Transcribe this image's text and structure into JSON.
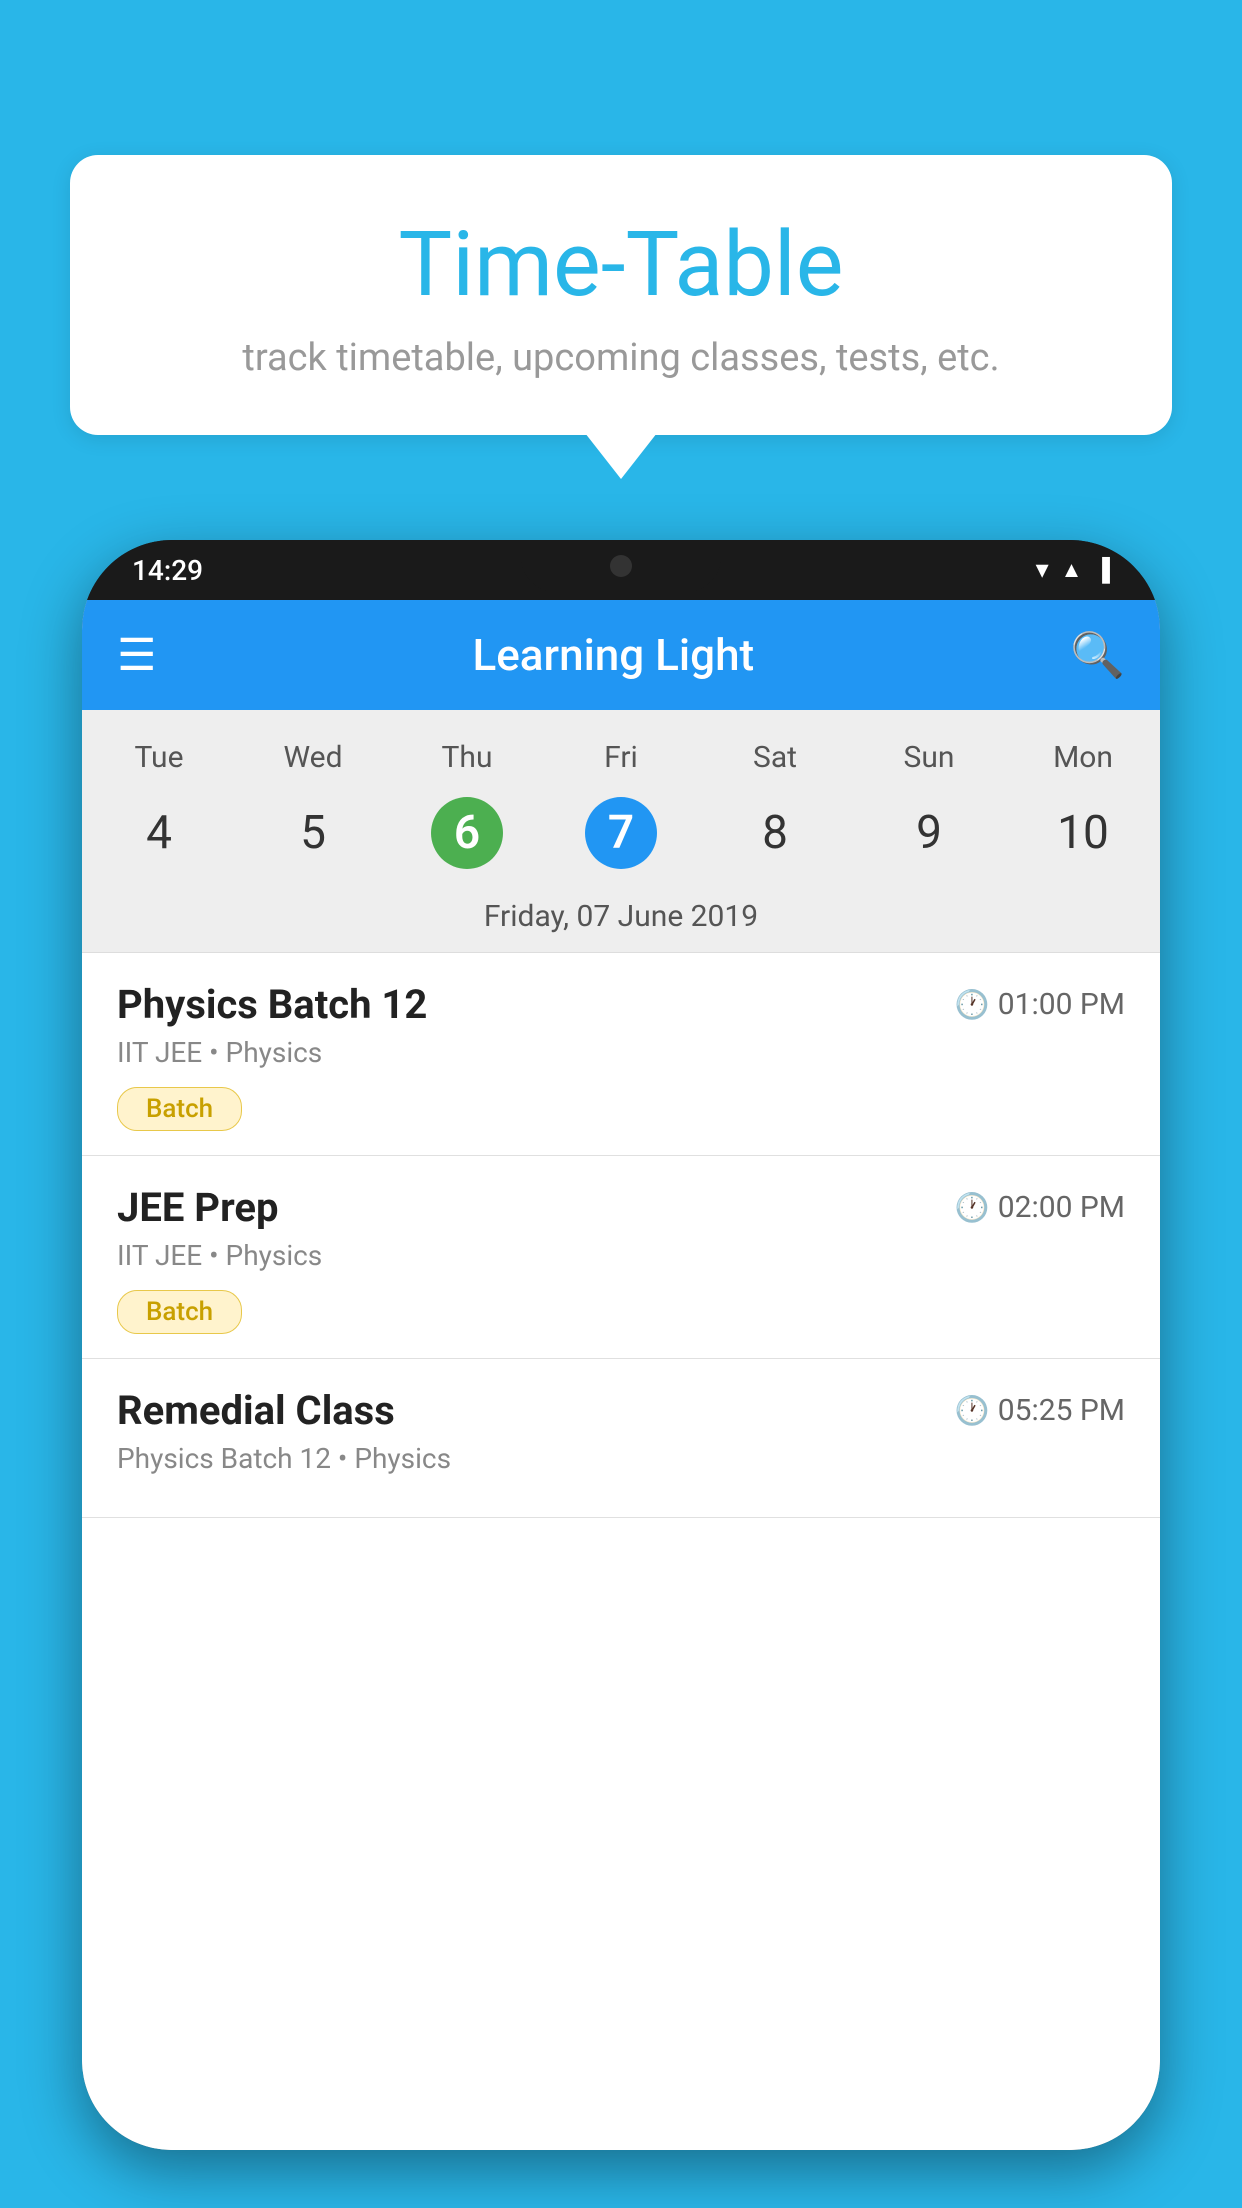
{
  "background_color": "#29b6e8",
  "bubble": {
    "title": "Time-Table",
    "subtitle": "track timetable, upcoming classes, tests, etc."
  },
  "phone": {
    "status_bar": {
      "time": "14:29"
    },
    "app_bar": {
      "title": "Learning Light"
    },
    "calendar": {
      "day_headers": [
        "Tue",
        "Wed",
        "Thu",
        "Fri",
        "Sat",
        "Sun",
        "Mon"
      ],
      "day_numbers": [
        "4",
        "5",
        "6",
        "7",
        "8",
        "9",
        "10"
      ],
      "today_index": 2,
      "selected_index": 3,
      "selected_date_label": "Friday, 07 June 2019"
    },
    "schedule_items": [
      {
        "title": "Physics Batch 12",
        "time": "01:00 PM",
        "subtitle": "IIT JEE • Physics",
        "badge": "Batch"
      },
      {
        "title": "JEE Prep",
        "time": "02:00 PM",
        "subtitle": "IIT JEE • Physics",
        "badge": "Batch"
      },
      {
        "title": "Remedial Class",
        "time": "05:25 PM",
        "subtitle": "Physics Batch 12 • Physics",
        "badge": null
      }
    ]
  }
}
